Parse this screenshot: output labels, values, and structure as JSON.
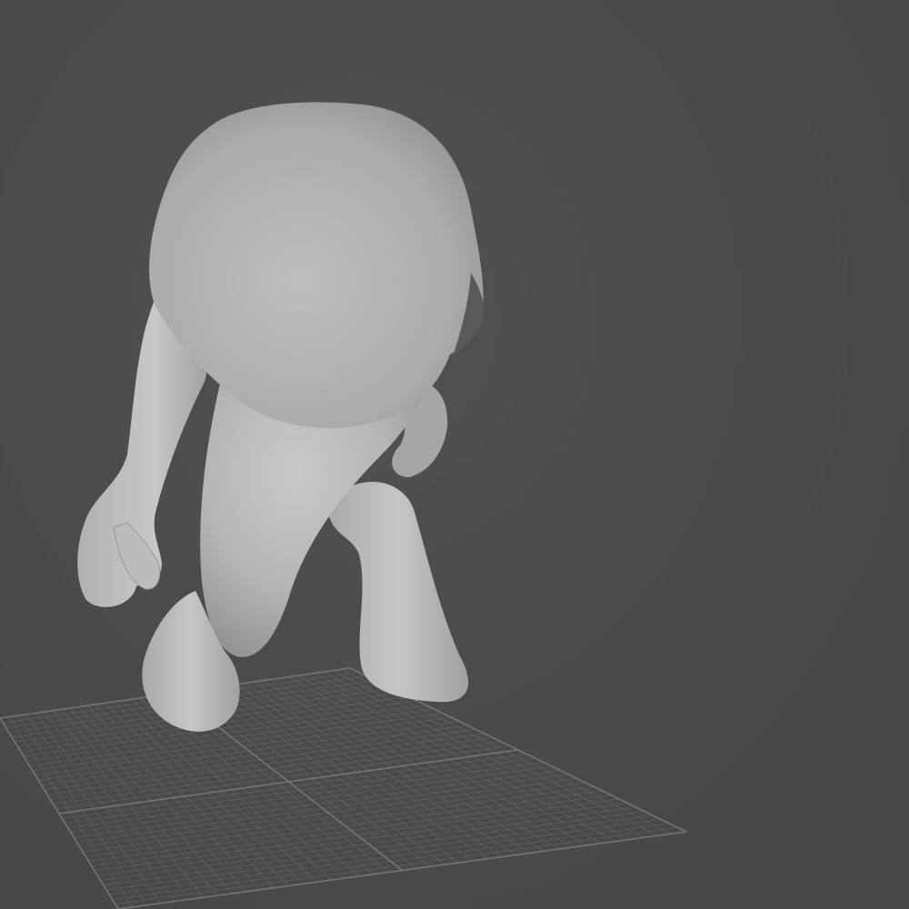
{
  "viewport": {
    "background_color": "#4a4a4a",
    "grid_color": "#7a7a7a",
    "model_color": "#bdbdbd"
  },
  "scene": {
    "objects": [
      {
        "id": "character-model",
        "icon": "sculpt-mesh"
      },
      {
        "id": "ground-grid",
        "icon": "grid-floor"
      }
    ]
  }
}
